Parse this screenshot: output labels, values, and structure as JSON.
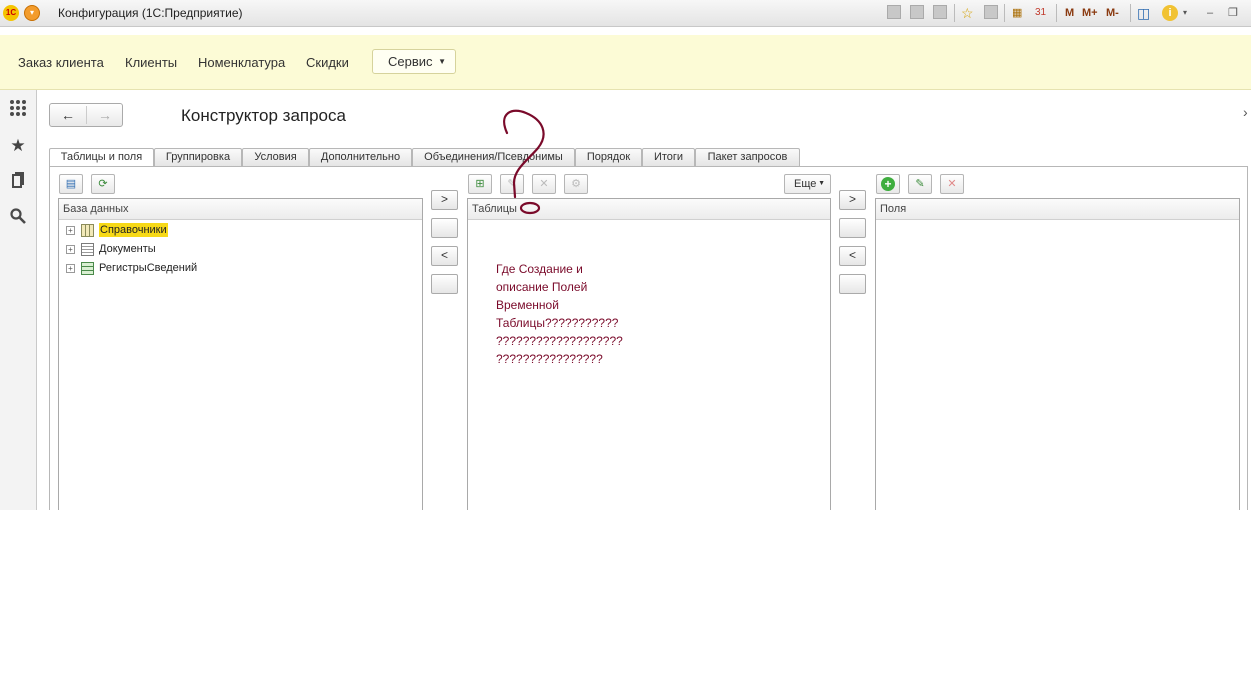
{
  "window": {
    "title": "Конфигурация  (1С:Предприятие)",
    "toolbar_labels": [
      "M",
      "M+",
      "M-"
    ]
  },
  "sections": {
    "items": [
      "Заказ клиента",
      "Клиенты",
      "Номенклатура",
      "Скидки"
    ],
    "service_label": "Сервис"
  },
  "form": {
    "title": "Конструктор запроса",
    "tabs": [
      "Таблицы и поля",
      "Группировка",
      "Условия",
      "Дополнительно",
      "Объединения/Псевдонимы",
      "Порядок",
      "Итоги",
      "Пакет запросов"
    ],
    "more_label": "Еще",
    "database": {
      "header": "База данных",
      "items": [
        {
          "label": "Справочники",
          "icon": "catalog-icon"
        },
        {
          "label": "Документы",
          "icon": "document-icon"
        },
        {
          "label": "РегистрыСведений",
          "icon": "register-icon"
        }
      ]
    },
    "tables": {
      "header": "Таблицы"
    },
    "fields": {
      "header": "Поля"
    },
    "arrows": {
      "move_right": ">",
      "move_left": "<"
    }
  },
  "annotation": {
    "text": "Где Создание и\nописание Полей\nВременной\nТаблицы???????????\n???????????????????\n????????????????",
    "mark": "?",
    "color": "#7a0a2a"
  },
  "colors": {
    "section_bg": "#fcfbd6",
    "highlight": "#f7d917",
    "accent_green": "#3fae3f"
  }
}
